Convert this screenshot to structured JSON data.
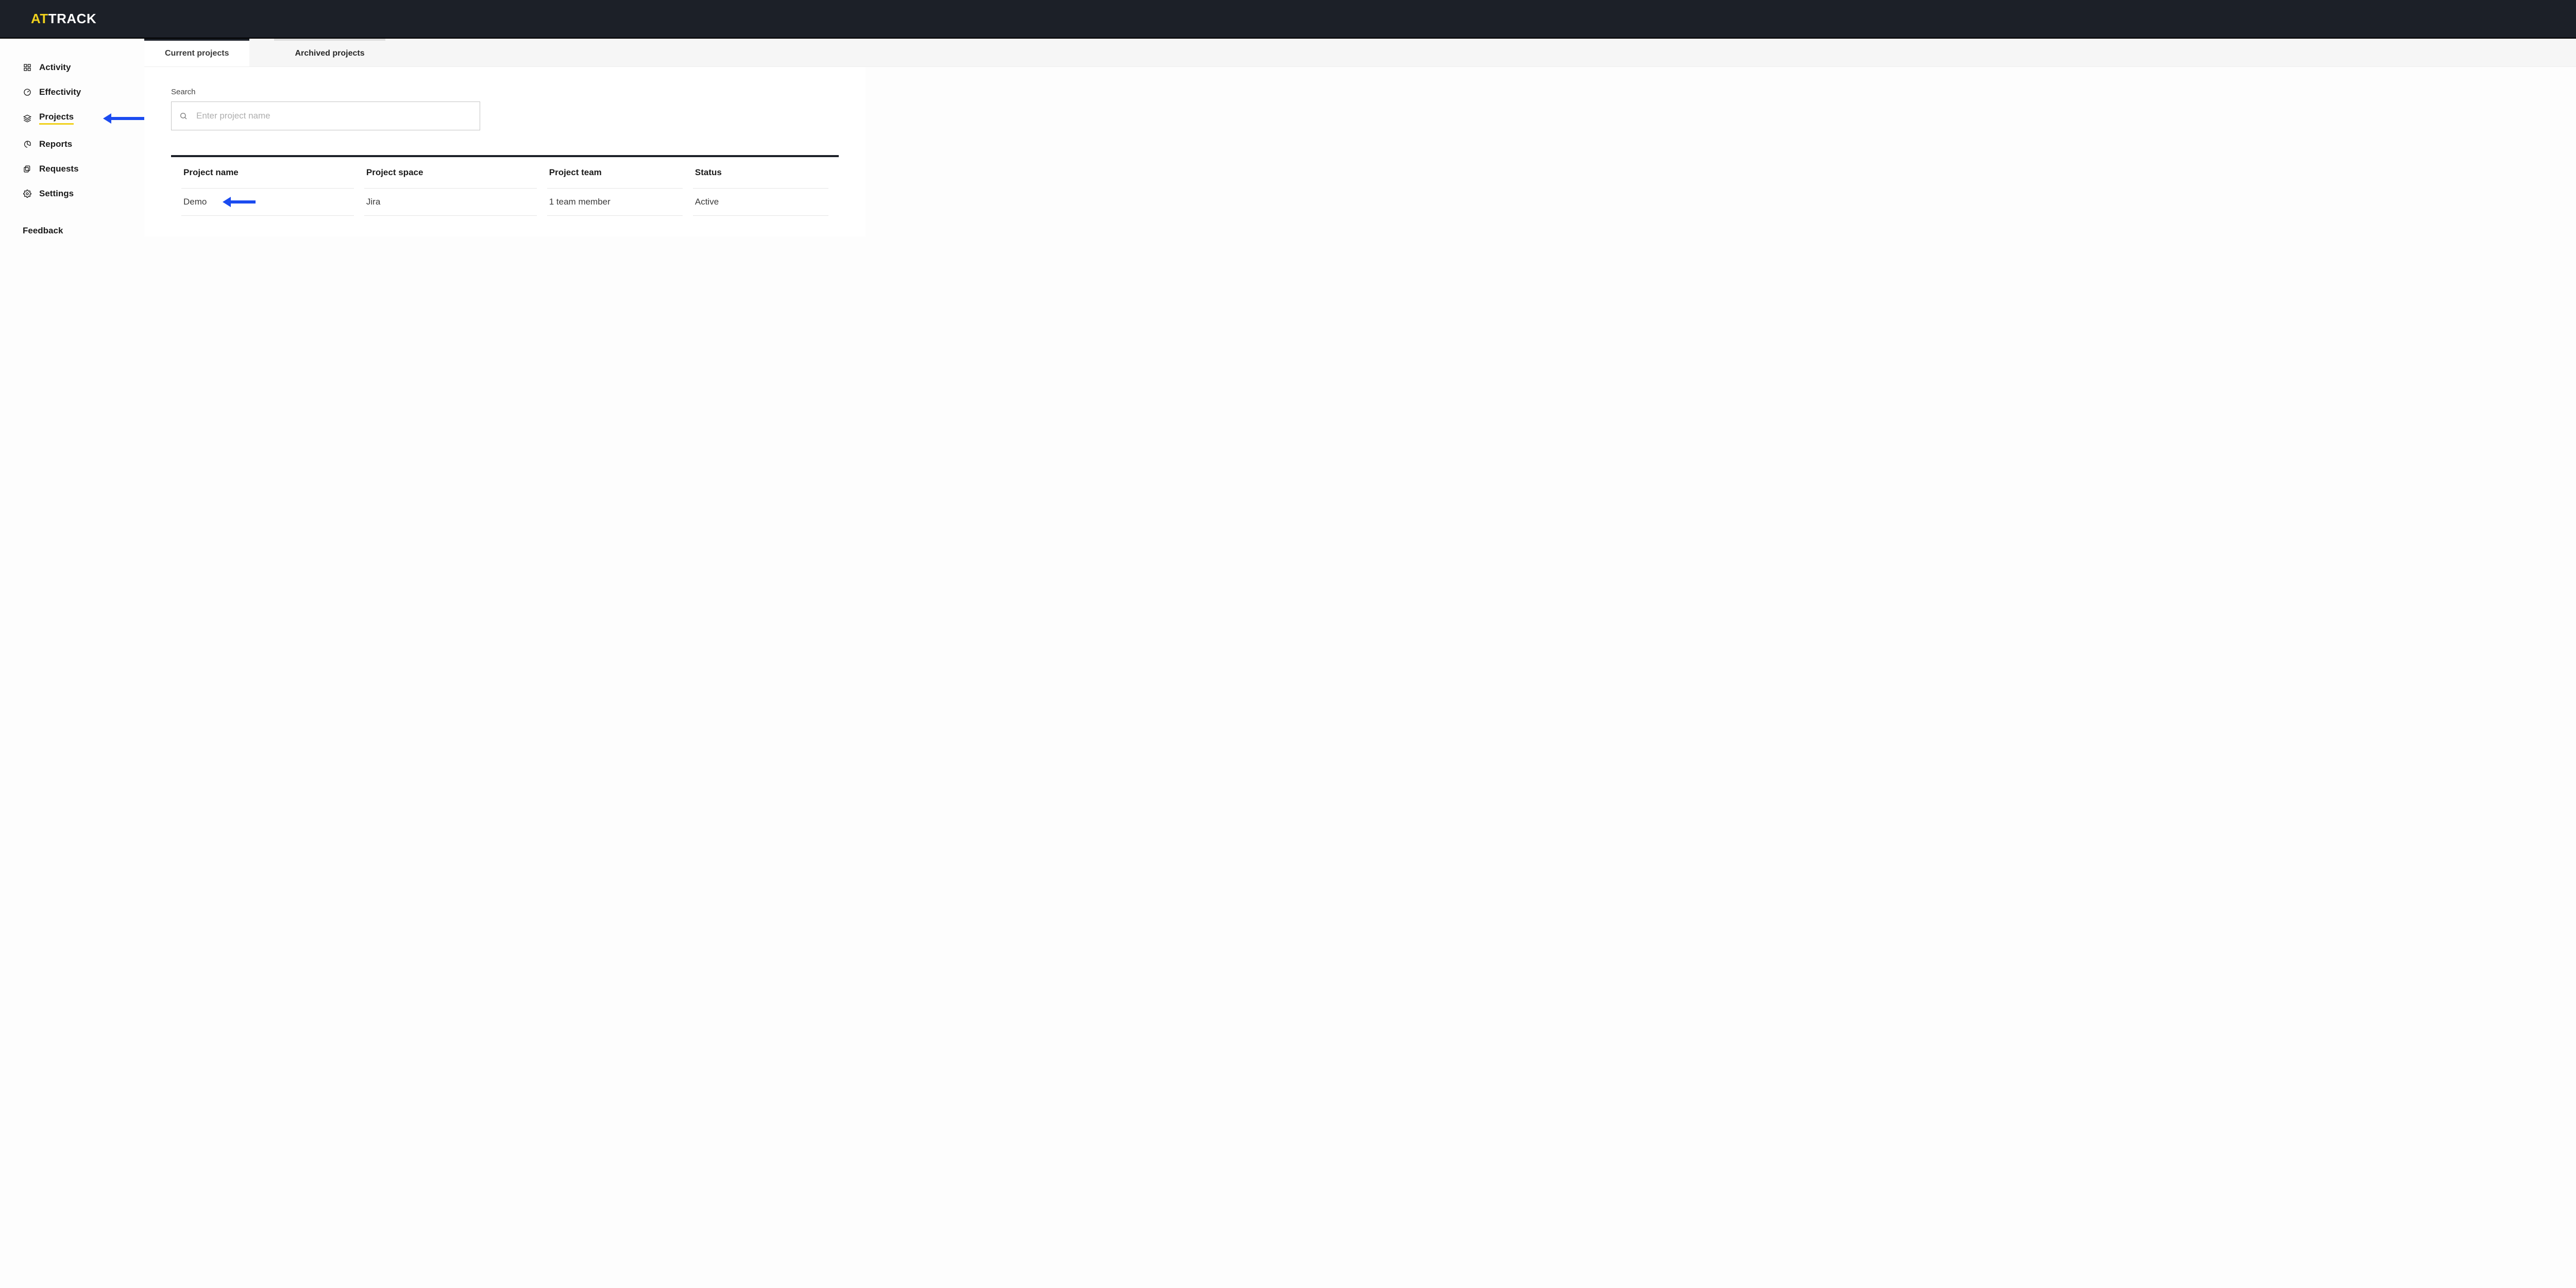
{
  "brand": {
    "logo_prefix": "AT",
    "logo_rest": "TRACK"
  },
  "sidebar": {
    "items": [
      {
        "label": "Activity",
        "active": false
      },
      {
        "label": "Effectivity",
        "active": false
      },
      {
        "label": "Projects",
        "active": true
      },
      {
        "label": "Reports",
        "active": false
      },
      {
        "label": "Requests",
        "active": false
      },
      {
        "label": "Settings",
        "active": false
      }
    ],
    "feedback_label": "Feedback"
  },
  "tabs": [
    {
      "label": "Current projects",
      "active": true
    },
    {
      "label": "Archived projects",
      "active": false
    }
  ],
  "search": {
    "label": "Search",
    "placeholder": "Enter project name",
    "value": ""
  },
  "table": {
    "columns": [
      "Project name",
      "Project space",
      "Project team",
      "Status"
    ],
    "rows": [
      {
        "name": "Demo",
        "space": "Jira",
        "team": "1 team member",
        "status": "Active"
      }
    ]
  }
}
